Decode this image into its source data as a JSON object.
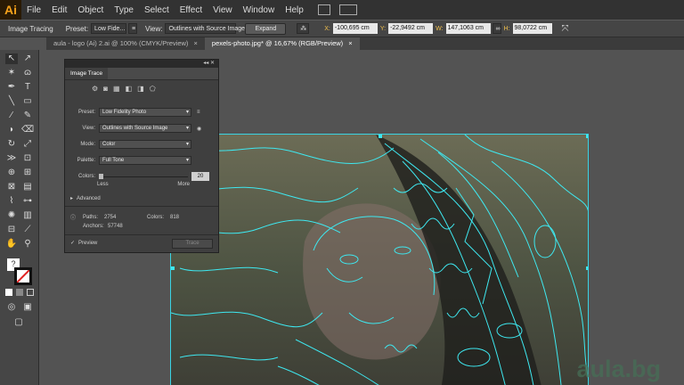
{
  "app": {
    "logo": "Ai"
  },
  "menu": [
    "File",
    "Edit",
    "Object",
    "Type",
    "Select",
    "Effect",
    "View",
    "Window",
    "Help"
  ],
  "control_bar": {
    "mode_label": "Image Tracing",
    "preset_label": "Preset:",
    "preset_value": "Low Fide...",
    "view_label": "View:",
    "view_value": "Outlines with Source Image",
    "expand_button": "Expand",
    "x_label": "X:",
    "x_value": "-100,695 cm",
    "y_label": "Y:",
    "y_value": "-22,9492 cm",
    "w_label": "W:",
    "w_value": "147,1063 cm",
    "h_label": "H:",
    "h_value": "98,0722 cm"
  },
  "tabs": [
    {
      "label": "aula - logo (Ai) 2.ai @ 100% (CMYK/Preview)",
      "close": "×"
    },
    {
      "label": "pexels-photo.jpg* @ 16,67% (RGB/Preview)",
      "close": "×"
    }
  ],
  "image_trace_panel": {
    "title": "Image Trace",
    "header_controls": "◂◂  ✕",
    "preset_label": "Preset:",
    "preset_value": "Low Fidelity Photo",
    "view_label": "View:",
    "view_value": "Outlines with Source Image",
    "mode_label": "Mode:",
    "mode_value": "Color",
    "palette_label": "Palette:",
    "palette_value": "Full Tone",
    "colors_label": "Colors:",
    "colors_value": "20",
    "colors_fraction": 0.0,
    "less_label": "Less",
    "more_label": "More",
    "advanced_label": "Advanced",
    "paths_label": "Paths:",
    "paths_value": "2754",
    "colors_count_label": "Colors:",
    "colors_count_value": "818",
    "anchors_label": "Anchors:",
    "anchors_value": "57748",
    "preview_label": "Preview",
    "trace_button": "Trace"
  },
  "watermark": "aula.bg",
  "colors": {
    "trace_outline": "#3ee8f0",
    "accent_orange": "#f7a21b"
  }
}
